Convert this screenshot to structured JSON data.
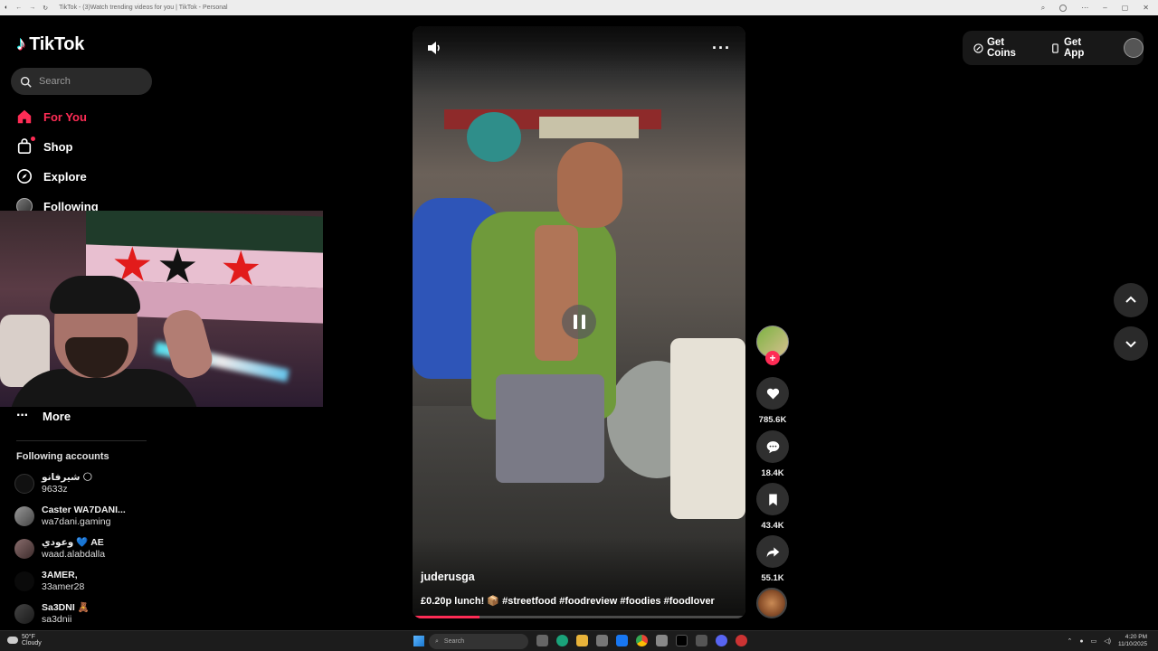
{
  "browser": {
    "title": "TikTok - (3)Watch trending videos for you | TikTok - Personal"
  },
  "sidebar": {
    "logo": "TikTok",
    "search_placeholder": "Search",
    "nav": [
      {
        "label": "For You",
        "icon": "home-icon",
        "active": true
      },
      {
        "label": "Shop",
        "icon": "shopping-bag-icon",
        "active": false
      },
      {
        "label": "Explore",
        "icon": "compass-icon",
        "active": false
      },
      {
        "label": "Following",
        "icon": "following-avatar-icon",
        "active": false
      }
    ],
    "more_label": "More",
    "following_title": "Following accounts",
    "accounts": [
      {
        "display": "شيرفانو 🌕",
        "handle": "9633z"
      },
      {
        "display": "Caster WA7DANI...",
        "handle": "wa7dani.gaming"
      },
      {
        "display": "وعودي 💙 AE",
        "handle": "waad.alabdalla"
      },
      {
        "display": "3AMER,",
        "handle": "33amer28"
      },
      {
        "display": "Sa3DNI 🧸",
        "handle": "sa3dnii"
      }
    ]
  },
  "video": {
    "author": "juderusga",
    "caption_text": "£0.20p lunch! 📦",
    "caption_tags": "#streetfood #foodreview #foodies #foodlover",
    "progress_fraction": 0.2
  },
  "actions": {
    "likes": "785.6K",
    "comments": "18.4K",
    "saves": "43.4K",
    "shares": "55.1K"
  },
  "header": {
    "get_coins": "Get Coins",
    "get_app": "Get App"
  },
  "taskbar": {
    "weather_temp": "50°F",
    "weather_desc": "Cloudy",
    "search_placeholder": "Search",
    "time": "4:20 PM",
    "date": "11/10/2025"
  },
  "colors": {
    "accent": "#fe2c55",
    "background": "#000000"
  }
}
